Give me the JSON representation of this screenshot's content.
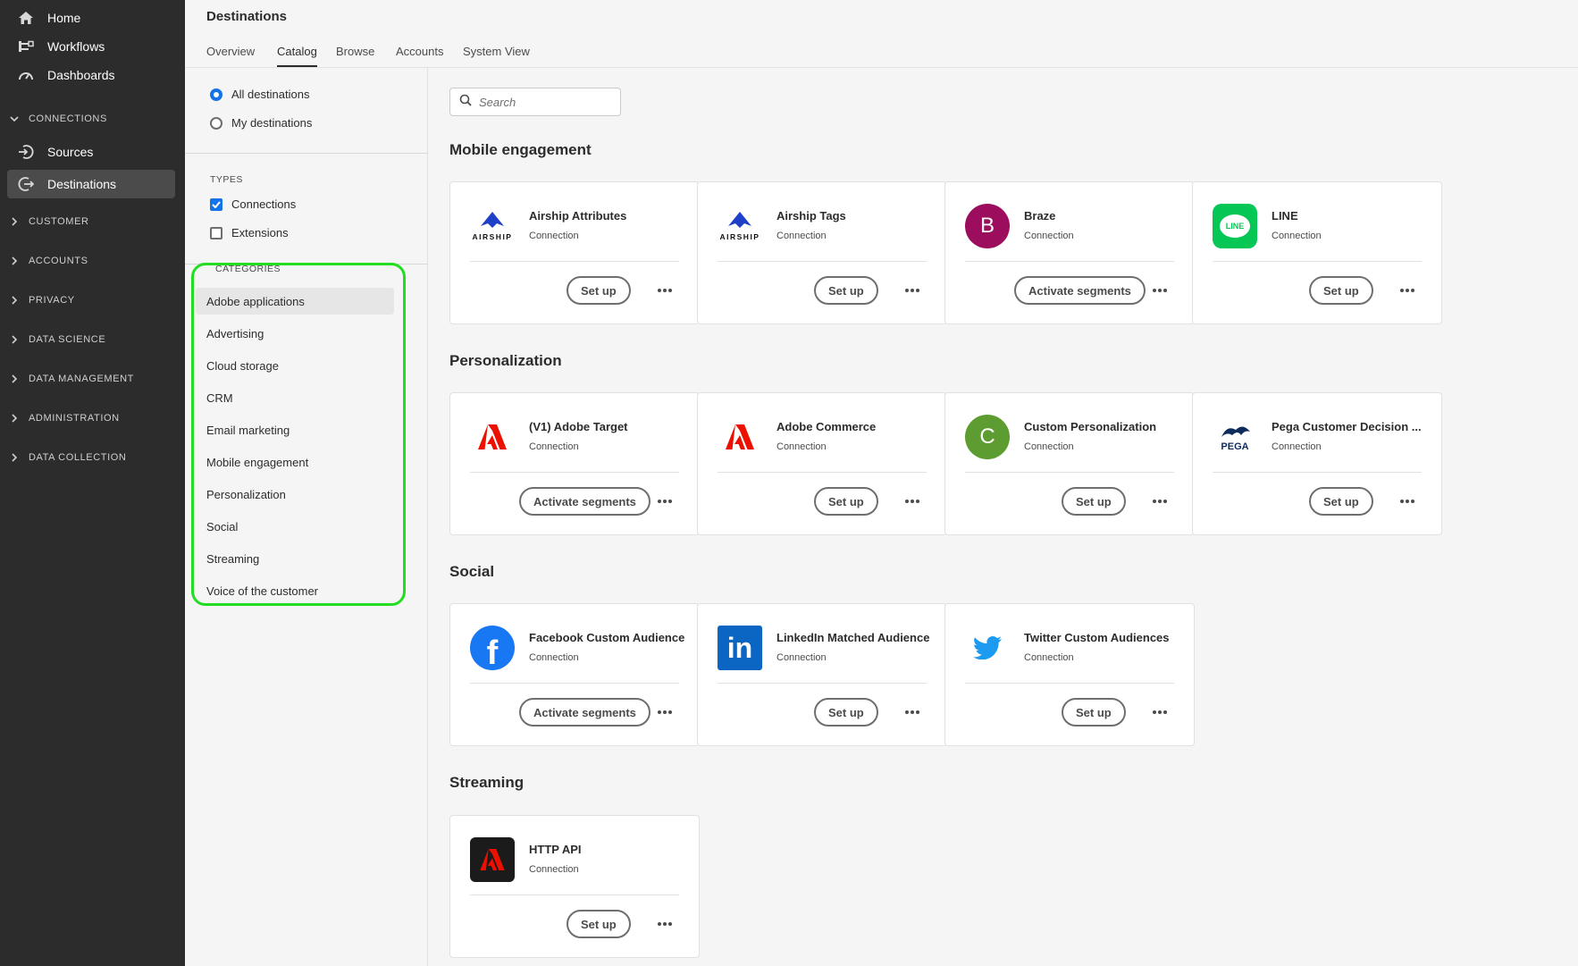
{
  "leftnav": {
    "items": [
      {
        "label": "Home",
        "icon": "home-icon"
      },
      {
        "label": "Workflows",
        "icon": "workflow-icon"
      },
      {
        "label": "Dashboards",
        "icon": "dashboard-icon"
      }
    ],
    "connections_section": "CONNECTIONS",
    "connections_items": [
      {
        "label": "Sources",
        "icon": "sources-icon"
      },
      {
        "label": "Destinations",
        "icon": "destinations-icon",
        "active": true
      }
    ],
    "sections": [
      "CUSTOMER",
      "ACCOUNTS",
      "PRIVACY",
      "DATA SCIENCE",
      "DATA MANAGEMENT",
      "ADMINISTRATION",
      "DATA COLLECTION"
    ]
  },
  "header": {
    "title": "Destinations",
    "tabs": [
      "Overview",
      "Catalog",
      "Browse",
      "Accounts",
      "System View"
    ],
    "active_tab": "Catalog"
  },
  "filters": {
    "scope": [
      {
        "label": "All destinations",
        "checked": true
      },
      {
        "label": "My destinations",
        "checked": false
      }
    ],
    "types_label": "TYPES",
    "types": [
      {
        "label": "Connections",
        "checked": true
      },
      {
        "label": "Extensions",
        "checked": false
      }
    ],
    "categories_label": "CATEGORIES",
    "categories": [
      "Adobe applications",
      "Advertising",
      "Cloud storage",
      "CRM",
      "Email marketing",
      "Mobile engagement",
      "Personalization",
      "Social",
      "Streaming",
      "Voice of the customer"
    ],
    "selected_category": "Adobe applications"
  },
  "search": {
    "placeholder": "Search"
  },
  "sections": [
    {
      "title": "Mobile engagement",
      "cards": [
        {
          "name": "Airship Attributes",
          "type": "Connection",
          "action": "Set up",
          "logo": "airship-logo",
          "logo_text": "AIRSHIP"
        },
        {
          "name": "Airship Tags",
          "type": "Connection",
          "action": "Set up",
          "logo": "airship-logo",
          "logo_text": "AIRSHIP"
        },
        {
          "name": "Braze",
          "type": "Connection",
          "action": "Activate segments",
          "logo": "braze-logo",
          "logo_text": "B"
        },
        {
          "name": "LINE",
          "type": "Connection",
          "action": "Set up",
          "logo": "line-logo",
          "logo_text": "LINE"
        }
      ]
    },
    {
      "title": "Personalization",
      "cards": [
        {
          "name": "(V1) Adobe Target",
          "type": "Connection",
          "action": "Activate segments",
          "logo": "adobe-logo"
        },
        {
          "name": "Adobe Commerce",
          "type": "Connection",
          "action": "Set up",
          "logo": "adobe-logo"
        },
        {
          "name": "Custom Personalization",
          "type": "Connection",
          "action": "Set up",
          "logo": "custom-personalization-logo",
          "logo_text": "C"
        },
        {
          "name": "Pega Customer Decision ...",
          "type": "Connection",
          "action": "Set up",
          "logo": "pega-logo",
          "logo_text": "PEGA"
        }
      ]
    },
    {
      "title": "Social",
      "cards": [
        {
          "name": "Facebook Custom Audience",
          "type": "Connection",
          "action": "Activate segments",
          "logo": "facebook-logo",
          "logo_text": "f"
        },
        {
          "name": "LinkedIn Matched Audience",
          "type": "Connection",
          "action": "Set up",
          "logo": "linkedin-logo",
          "logo_text": "in"
        },
        {
          "name": "Twitter Custom Audiences",
          "type": "Connection",
          "action": "Set up",
          "logo": "twitter-logo"
        }
      ]
    },
    {
      "title": "Streaming",
      "cards": [
        {
          "name": "HTTP API",
          "type": "Connection",
          "action": "Set up",
          "logo": "http-api-logo"
        }
      ]
    }
  ],
  "colors": {
    "nav_bg": "#2c2c2c",
    "accent_blue": "#1473e6",
    "highlight_green": "#22dd22",
    "adobe_red": "#eb1000",
    "braze_purple": "#9c0d5e",
    "line_green": "#06c755",
    "custom_green": "#5d9c31",
    "facebook_blue": "#1877f2",
    "linkedin_blue": "#0a66c2",
    "twitter_blue": "#1d9bf0"
  }
}
